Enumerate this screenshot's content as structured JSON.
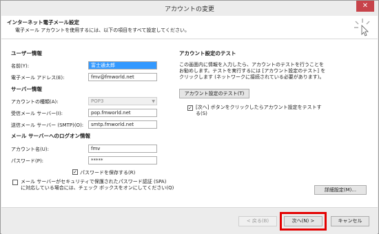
{
  "window": {
    "title": "アカウントの変更",
    "close": "✕"
  },
  "header": {
    "title": "インターネット電子メール設定",
    "subtitle": "電子メール アカウントを使用するには、以下の項目をすべて設定してください。"
  },
  "user_info": {
    "heading": "ユーザー情報",
    "name_label": "名前(Y):",
    "name_value": "富士通太郎",
    "email_label": "電子メール アドレス(E):",
    "email_value": "fmv@fmworld.net"
  },
  "server_info": {
    "heading": "サーバー情報",
    "account_type_label": "アカウントの種類(A):",
    "account_type_value": "POP3",
    "incoming_label": "受信メール サーバー(I):",
    "incoming_value": "pop.fmworld.net",
    "outgoing_label": "送信メール サーバー (SMTP)(O):",
    "outgoing_value": "smtp.fmworld.net"
  },
  "logon_info": {
    "heading": "メール サーバーへのログオン情報",
    "account_label": "アカウント名(U):",
    "account_value": "fmv",
    "password_label": "パスワード(P):",
    "password_value": "*****",
    "remember_label": "パスワードを保存する(R)",
    "remember_checked": "✓",
    "spa_label_line1": "メール サーバーがセキュリティで保護されたパスワード認証 (SPA)",
    "spa_label_line2": "に対応している場合には、チェック ボックスをオンにしてください(Q)"
  },
  "test": {
    "heading": "アカウント設定のテスト",
    "desc_line1": "この画面内に情報を入力したら、アカウントのテストを行うことを",
    "desc_line2": "お勧めします。テストを実行するには [アカウント設定のテスト] を",
    "desc_line3": "クリックします (ネットワークに接続されている必要があります)。",
    "test_button": "アカウント設定のテスト(T)",
    "auto_test_line1": "[次へ] ボタンをクリックしたらアカウント設定をテストす",
    "auto_test_line2": "る(S)",
    "auto_test_checked": "✓",
    "more_settings_button": "詳細設定(M)..."
  },
  "footer": {
    "back_button": "< 戻る(B)",
    "next_button": "次へ(N) >",
    "cancel_button": "キャンセル"
  },
  "colors": {
    "highlight": "#e30000",
    "selection": "#3399ff",
    "close": "#c7434a"
  }
}
